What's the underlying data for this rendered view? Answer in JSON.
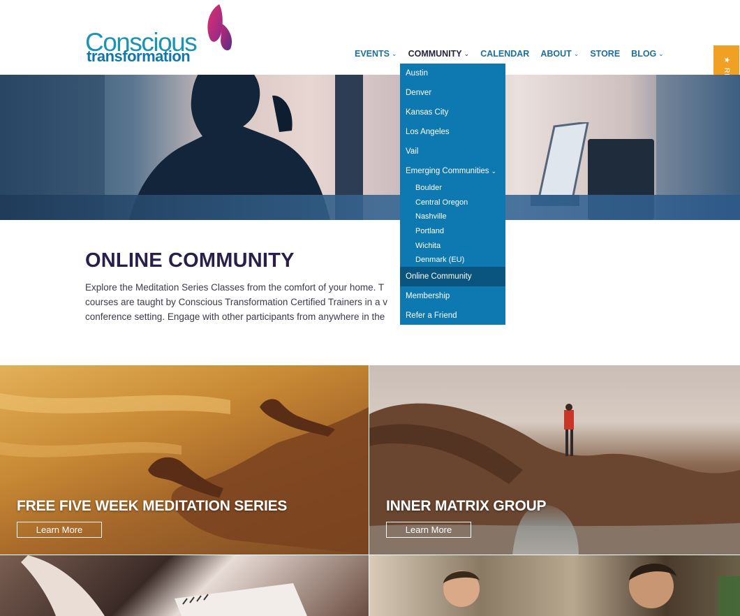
{
  "brand": {
    "line1": "Conscious",
    "line2": "transformation"
  },
  "nav": {
    "items": [
      {
        "label": "EVENTS",
        "has_caret": true
      },
      {
        "label": "COMMUNITY",
        "has_caret": true,
        "active": true
      },
      {
        "label": "CALENDAR",
        "has_caret": false
      },
      {
        "label": "ABOUT",
        "has_caret": true
      },
      {
        "label": "STORE",
        "has_caret": false
      },
      {
        "label": "BLOG",
        "has_caret": true
      }
    ],
    "caret_glyph": "⌄"
  },
  "dropdown": {
    "items": [
      {
        "label": "Austin"
      },
      {
        "label": "Denver"
      },
      {
        "label": "Kansas City"
      },
      {
        "label": "Los Angeles"
      },
      {
        "label": "Vail"
      },
      {
        "label": "Emerging Communities"
      },
      {
        "label": "Boulder"
      },
      {
        "label": "Central Oregon"
      },
      {
        "label": "Nashville"
      },
      {
        "label": "Portland"
      },
      {
        "label": "Wichita"
      },
      {
        "label": "Denmark (EU)"
      },
      {
        "label": "Online Community"
      },
      {
        "label": "Membership"
      },
      {
        "label": "Refer a Friend"
      }
    ],
    "selected": "Online Community"
  },
  "reviews": {
    "label": "REVIEWS",
    "star": "★"
  },
  "intro": {
    "title": "ONLINE COMMUNITY",
    "text": "Explore the Meditation Series Classes from the comfort of your home. T courses are taught by Conscious Transformation Certified Trainers in a v conference setting. Engage with other participants from anywhere in the"
  },
  "tiles": [
    {
      "title": "FREE FIVE WEEK MEDITATION SERIES",
      "button": "Learn More"
    },
    {
      "title": "INNER MATRIX GROUP",
      "button": "Learn More"
    }
  ],
  "colors": {
    "nav_link": "#1b6f9e",
    "nav_active": "#24243c",
    "dropdown_bg": "#0e78b0",
    "dropdown_selected": "#0a5580",
    "reviews_bg": "#f0a022",
    "title": "#2a1e4a"
  }
}
